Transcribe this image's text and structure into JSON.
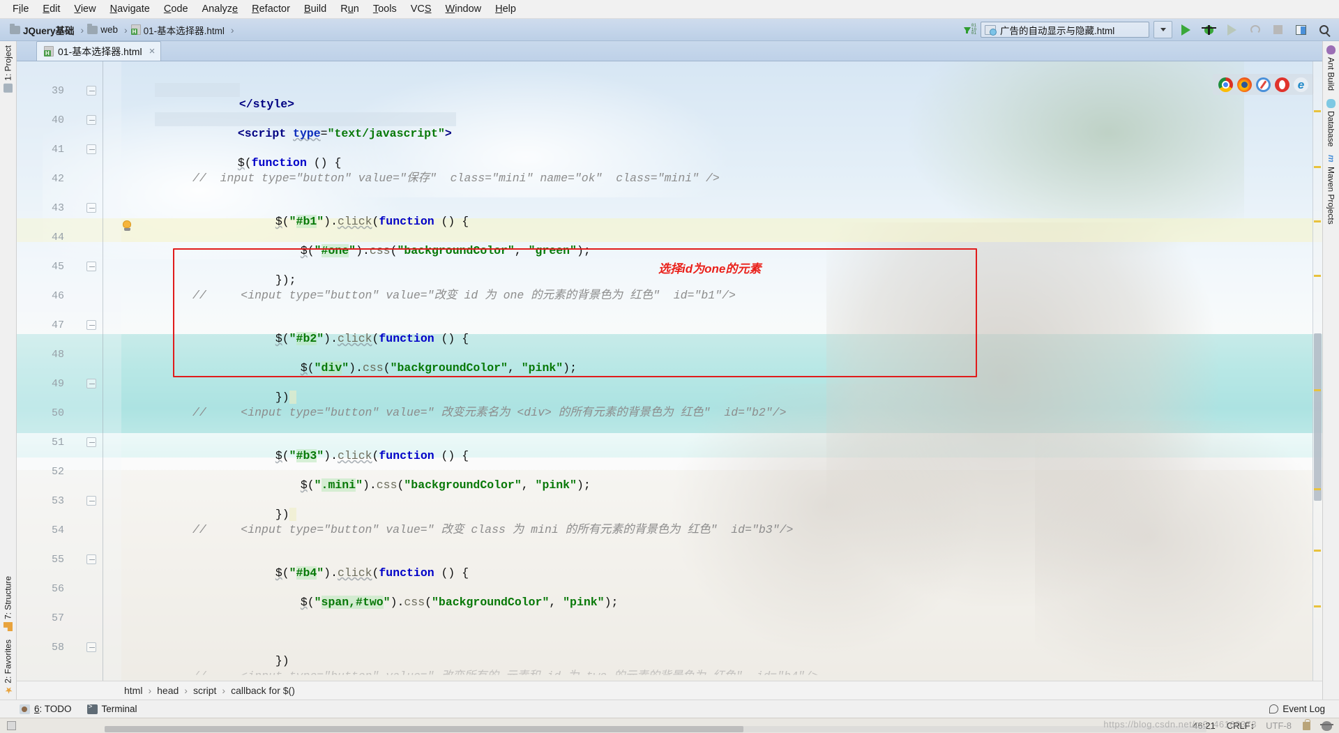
{
  "menubar": {
    "items": [
      {
        "pre": "F",
        "mn": "i",
        "post": "le"
      },
      {
        "pre": "",
        "mn": "E",
        "post": "dit"
      },
      {
        "pre": "",
        "mn": "V",
        "post": "iew"
      },
      {
        "pre": "",
        "mn": "N",
        "post": "avigate"
      },
      {
        "pre": "",
        "mn": "C",
        "post": "ode"
      },
      {
        "pre": "Analyz",
        "mn": "e",
        "post": ""
      },
      {
        "pre": "",
        "mn": "R",
        "post": "efactor"
      },
      {
        "pre": "",
        "mn": "B",
        "post": "uild"
      },
      {
        "pre": "R",
        "mn": "u",
        "post": "n"
      },
      {
        "pre": "",
        "mn": "T",
        "post": "ools"
      },
      {
        "pre": "VC",
        "mn": "S",
        "post": ""
      },
      {
        "pre": "",
        "mn": "W",
        "post": "indow"
      },
      {
        "pre": "",
        "mn": "H",
        "post": "elp"
      }
    ]
  },
  "navbar": {
    "crumbs": [
      {
        "label": "JQuery基础",
        "icon": "folder-icon",
        "bold": true
      },
      {
        "label": "web",
        "icon": "folder-icon",
        "bold": false
      },
      {
        "label": "01-基本选择器.html",
        "icon": "html-file-icon",
        "bold": false
      }
    ],
    "separator": "›",
    "run_config": "广告的自动显示与隐藏.html",
    "download_bits": [
      "01",
      "10",
      "01"
    ],
    "toolbar_icons": [
      "run-config-chevron-icon",
      "run-icon",
      "debug-icon",
      "run-with-coverage-icon",
      "profile-icon",
      "stop-icon",
      "layout-icon",
      "search-everywhere-icon"
    ]
  },
  "left_stripe": {
    "top": [
      {
        "label": "1: Project",
        "icon": "project-icon"
      }
    ],
    "bottom": [
      {
        "label": "7: Structure",
        "icon": "structure-icon"
      },
      {
        "label": "2: Favorites",
        "icon": "favorites-star-icon"
      }
    ]
  },
  "right_stripe": {
    "items": [
      {
        "label": "Ant Build",
        "icon": "ant-icon"
      },
      {
        "label": "Database",
        "icon": "database-icon"
      },
      {
        "label": "Maven Projects",
        "icon": "maven-icon"
      }
    ]
  },
  "editor_tab": {
    "label": "01-基本选择器.html",
    "icon": "html-file-icon",
    "close": "×"
  },
  "browser_bar": {
    "icons": [
      "chrome-icon",
      "firefox-icon",
      "safari-icon",
      "opera-icon",
      "internet-explorer-icon"
    ]
  },
  "annotation": {
    "note_text": "选择id为one的元素",
    "box_color": "#e01b1b",
    "note_color": "#e8201a"
  },
  "code": {
    "first_line": 39,
    "highlighted_line": 46,
    "lines": [
      {
        "n": 39,
        "indent": 0,
        "text": "</style>"
      },
      {
        "n": 40,
        "indent": 0,
        "text": "<script type=\"text/javascript\">"
      },
      {
        "n": 41,
        "indent": 0,
        "text": "$(function () {"
      },
      {
        "n": 42,
        "indent": 0,
        "text": "//  input type=\"button\" value=\"保存\"  class=\"mini\" name=\"ok\"  class=\"mini\" />"
      },
      {
        "n": 43,
        "indent": 0,
        "text": "$(\"#b1\").click(function () {"
      },
      {
        "n": 44,
        "indent": 0,
        "text": "$(\"#one\").css(\"backgroundColor\", \"green\");"
      },
      {
        "n": 45,
        "indent": 0,
        "text": "});"
      },
      {
        "n": 46,
        "indent": 0,
        "text": "//     <input type=\"button\" value=\"改变 id 为 one 的元素的背景色为 红色\"  id=\"b1\"/>"
      },
      {
        "n": 47,
        "indent": 0,
        "text": "$(\"#b2\").click(function () {"
      },
      {
        "n": 48,
        "indent": 0,
        "text": "$(\"div\").css(\"backgroundColor\", \"pink\");"
      },
      {
        "n": 49,
        "indent": 0,
        "text": "})"
      },
      {
        "n": 50,
        "indent": 0,
        "text": "//     <input type=\"button\" value=\" 改变元素名为 <div> 的所有元素的背景色为 红色\"  id=\"b2\"/>"
      },
      {
        "n": 51,
        "indent": 0,
        "text": "$(\"#b3\").click(function () {"
      },
      {
        "n": 52,
        "indent": 0,
        "text": "$(\".mini\").css(\"backgroundColor\", \"pink\");"
      },
      {
        "n": 53,
        "indent": 0,
        "text": "})"
      },
      {
        "n": 54,
        "indent": 0,
        "text": "//     <input type=\"button\" value=\" 改变 class 为 mini 的所有元素的背景色为 红色\"  id=\"b3\"/>"
      },
      {
        "n": 55,
        "indent": 0,
        "text": "$(\"#b4\").click(function () {"
      },
      {
        "n": 56,
        "indent": 0,
        "text": "$(\"span,#two\").css(\"backgroundColor\", \"pink\");"
      },
      {
        "n": 57,
        "indent": 0,
        "text": ""
      },
      {
        "n": 58,
        "indent": 0,
        "text": "})"
      }
    ]
  },
  "breadcrumb_bar": {
    "items": [
      "html",
      "head",
      "script",
      "callback for $()"
    ],
    "separator": "›"
  },
  "bottom_bar": {
    "items": [
      {
        "label_pre": "",
        "label_mn": "6",
        "label_post": ": TODO",
        "icon": "todo-icon"
      },
      {
        "label_pre": "Terminal",
        "label_mn": "",
        "label_post": "",
        "icon": "terminal-icon"
      }
    ],
    "event_log": "Event Log",
    "event_log_icon": "speech-bubble-icon"
  },
  "status_bar": {
    "caret": "46:21",
    "line_separator": "CRLF",
    "encoding": "UTF-8",
    "lock_icon": "lock-icon",
    "face_icon": "hector-inspection-icon",
    "watermark": "https://blog.csdn.net/m0_46160373"
  }
}
